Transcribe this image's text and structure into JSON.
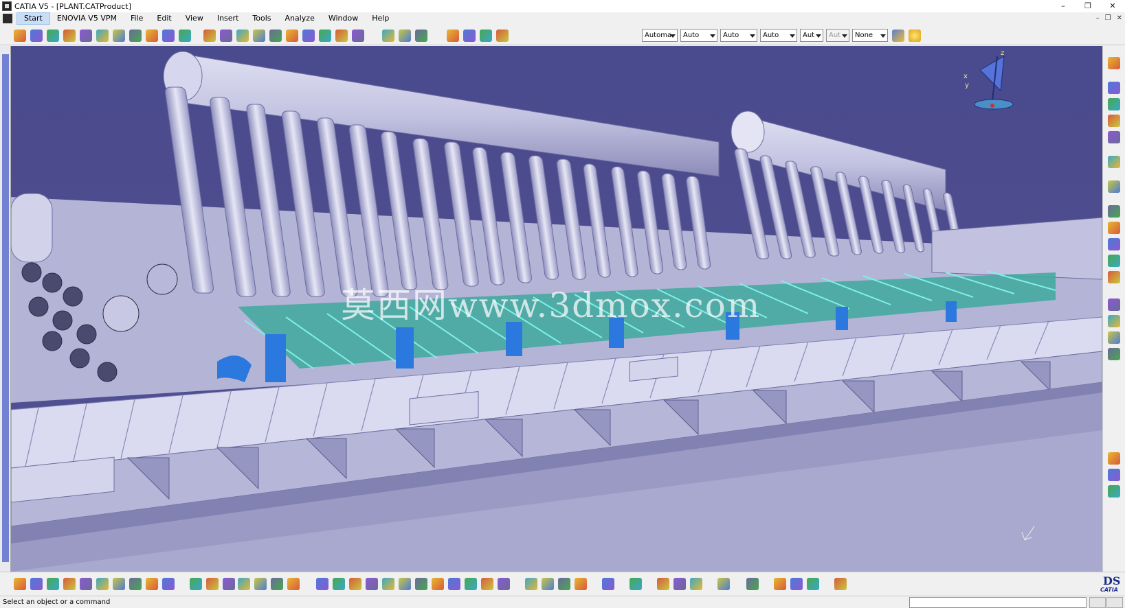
{
  "window": {
    "title": "CATIA V5 - [PLANT.CATProduct]",
    "minimize": "–",
    "restore": "❐",
    "close": "✕"
  },
  "menu": {
    "items": [
      "Start",
      "ENOVIA V5 VPM",
      "File",
      "Edit",
      "View",
      "Insert",
      "Tools",
      "Analyze",
      "Window",
      "Help"
    ],
    "mdi": [
      "–",
      "❐",
      "✕"
    ]
  },
  "toolbar": {
    "combos": [
      {
        "value": "Automa"
      },
      {
        "value": "Auto"
      },
      {
        "value": "Auto"
      },
      {
        "value": "Auto"
      },
      {
        "value": "Aut"
      },
      {
        "value": "Aut"
      },
      {
        "value": "None"
      }
    ]
  },
  "compass": {
    "x_label": "x",
    "y_label": "y",
    "z_label": "z"
  },
  "watermark": "莫西网www.3dmox.com",
  "status": {
    "message": "Select an object or a command"
  },
  "logo": {
    "brand": "DS",
    "product": "CATIA"
  },
  "colors": {
    "background": "#4a4a8e",
    "model": "#c9c9e6",
    "accent_cyan": "#2fd6cf",
    "accent_blue": "#2878e0"
  }
}
